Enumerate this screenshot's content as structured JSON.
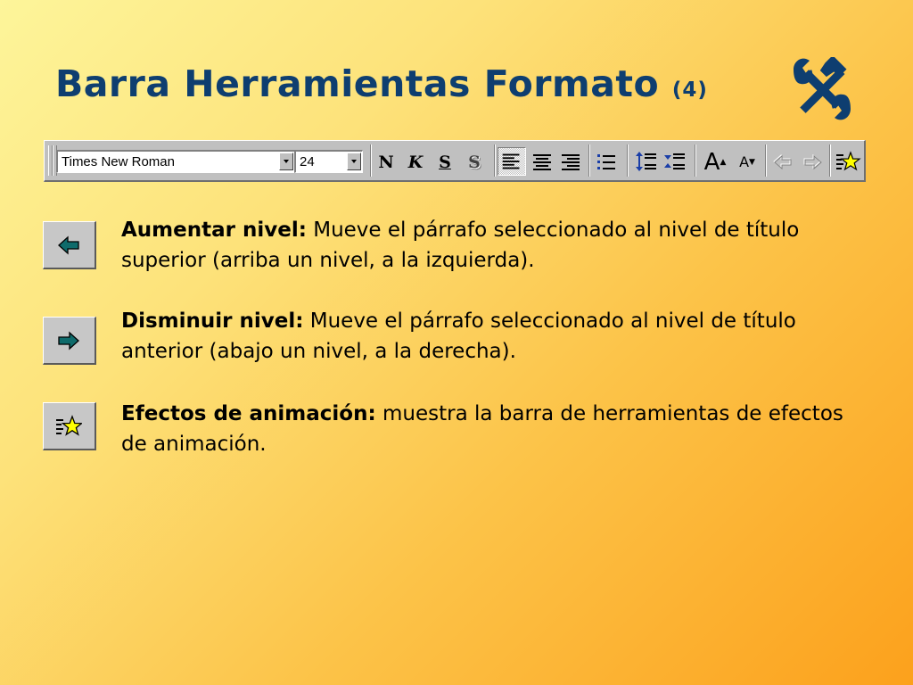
{
  "slide": {
    "title": "Barra Herramientas Formato",
    "title_number": "(4)",
    "icon": "tools-icon"
  },
  "toolbar": {
    "font_name": "Times New Roman",
    "font_size": "24",
    "buttons": [
      {
        "name": "bold-button",
        "glyph": "N"
      },
      {
        "name": "italic-button",
        "glyph": "K"
      },
      {
        "name": "underline-button",
        "glyph": "S"
      },
      {
        "name": "shadow-button",
        "glyph": "S"
      },
      {
        "name": "align-left-button",
        "icon": "align-left-icon",
        "pressed": true
      },
      {
        "name": "align-center-button",
        "icon": "align-center-icon"
      },
      {
        "name": "align-right-button",
        "icon": "align-right-icon"
      },
      {
        "name": "bullets-button",
        "icon": "bullets-icon"
      },
      {
        "name": "increase-spacing-button",
        "icon": "increase-spacing-icon"
      },
      {
        "name": "decrease-spacing-button",
        "icon": "decrease-spacing-icon"
      },
      {
        "name": "increase-font-button",
        "glyph": "A"
      },
      {
        "name": "decrease-font-button",
        "glyph": "A"
      },
      {
        "name": "promote-button",
        "icon": "arrow-left-icon",
        "disabled": true
      },
      {
        "name": "demote-button",
        "icon": "arrow-right-icon",
        "disabled": true
      },
      {
        "name": "animation-effects-button",
        "icon": "animation-star-icon"
      }
    ]
  },
  "descriptions": [
    {
      "icon": "arrow-left-icon",
      "term": "Aumentar nivel:",
      "text": "Mueve el párrafo seleccionado al nivel de título superior (arriba un nivel, a la izquierda)."
    },
    {
      "icon": "arrow-right-icon",
      "term": "Disminuir nivel:",
      "text": "Mueve el párrafo seleccionado al nivel de título anterior (abajo un nivel, a la derecha)."
    },
    {
      "icon": "animation-star-icon",
      "term": "Efectos de animación:",
      "text": "muestra la barra de herramientas de efectos de animación."
    }
  ],
  "colors": {
    "title": "#0e3e70",
    "icon_teal": "#0f6b6b",
    "star": "#ffff00"
  }
}
